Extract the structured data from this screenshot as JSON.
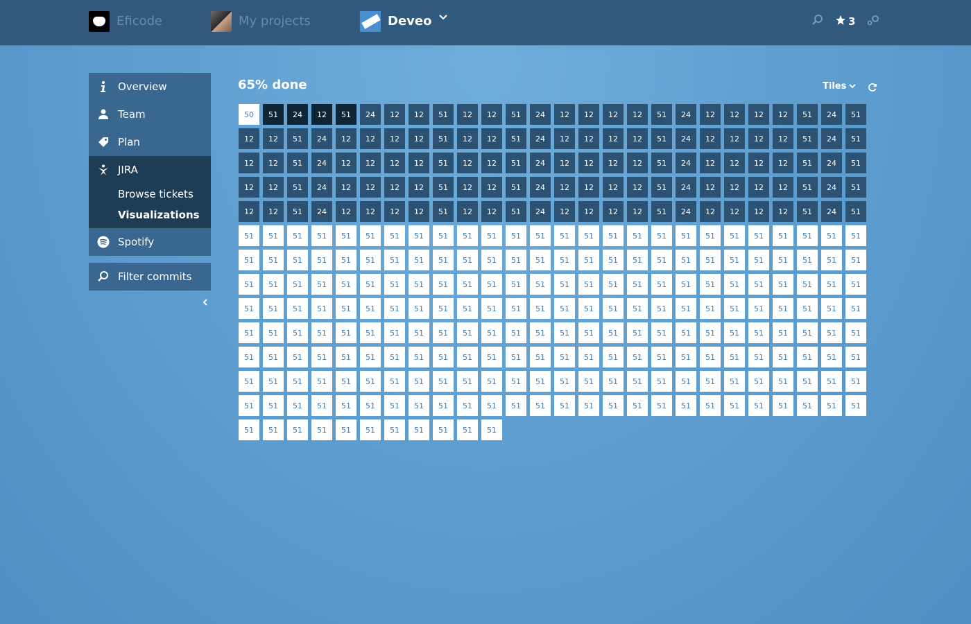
{
  "topbar": {
    "org": "Eficode",
    "projects": "My projects",
    "project": "Deveo",
    "star_count": "3",
    "icons": [
      "search-icon",
      "star-icon",
      "settings-icon"
    ]
  },
  "sidebar": {
    "items": [
      {
        "label": "Overview",
        "icon": "info-icon"
      },
      {
        "label": "Team",
        "icon": "person-icon"
      },
      {
        "label": "Plan",
        "icon": "tag-icon"
      },
      {
        "label": "JIRA",
        "icon": "jira-icon"
      },
      {
        "label": "Spotify",
        "icon": "spotify-icon"
      }
    ],
    "jira_sub": [
      "Browse tickets",
      "Visualizations"
    ],
    "filter": "Filter commits"
  },
  "main": {
    "title": "65% done",
    "view_label": "Tiles"
  },
  "colors": {
    "topbar": "#30597d",
    "tile_todo": "#ffffff",
    "tile_done": "#2b5273",
    "tile_dark": "#0f2538"
  },
  "tiles": {
    "columns": 26,
    "rows_done": [
      [
        "50:todo",
        "51:dark",
        "24:dark",
        "12:dark",
        "51:dark",
        "24",
        "12",
        "12",
        "51",
        "12",
        "12",
        "51",
        "24",
        "12",
        "12",
        "12",
        "12",
        "51",
        "24",
        "12",
        "12",
        "12",
        "12",
        "51",
        "24",
        "51"
      ],
      [
        "12",
        "12",
        "51",
        "24",
        "12",
        "12",
        "12",
        "12",
        "51",
        "12",
        "12",
        "51",
        "24",
        "12",
        "12",
        "12",
        "12",
        "51",
        "24",
        "12",
        "12",
        "12",
        "12",
        "51",
        "24",
        "51"
      ],
      [
        "12",
        "12",
        "51",
        "24",
        "12",
        "12",
        "12",
        "12",
        "51",
        "12",
        "12",
        "51",
        "24",
        "12",
        "12",
        "12",
        "12",
        "51",
        "24",
        "12",
        "12",
        "12",
        "12",
        "51",
        "24",
        "51"
      ],
      [
        "12",
        "12",
        "51",
        "24",
        "12",
        "12",
        "12",
        "12",
        "51",
        "12",
        "12",
        "51",
        "24",
        "12",
        "12",
        "12",
        "12",
        "51",
        "24",
        "12",
        "12",
        "12",
        "12",
        "51",
        "24",
        "51"
      ],
      [
        "12",
        "12",
        "51",
        "24",
        "12",
        "12",
        "12",
        "12",
        "51",
        "12",
        "12",
        "51",
        "24",
        "12",
        "12",
        "12",
        "12",
        "51",
        "24",
        "12",
        "12",
        "12",
        "12",
        "51",
        "24",
        "51"
      ]
    ],
    "todo_value": "51",
    "todo_count": 219
  }
}
